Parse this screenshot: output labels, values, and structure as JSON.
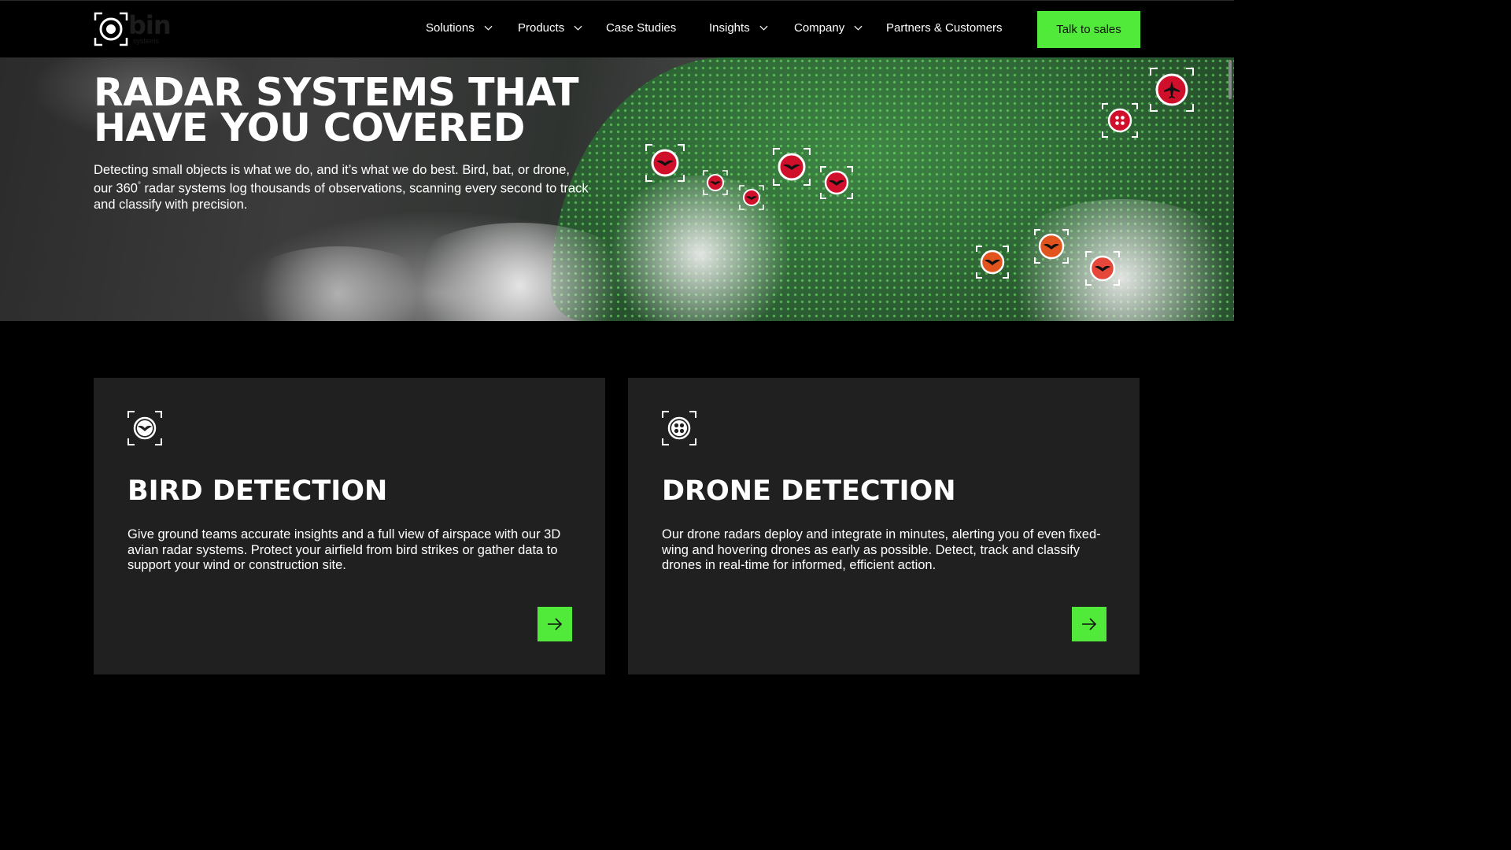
{
  "nav": {
    "logo_word": "bin",
    "logo_sub": "systems",
    "items": [
      {
        "label": "Solutions",
        "has_dropdown": true
      },
      {
        "label": "Products",
        "has_dropdown": true
      },
      {
        "label": "Case Studies",
        "has_dropdown": false
      },
      {
        "label": "Insights",
        "has_dropdown": true
      },
      {
        "label": "Company",
        "has_dropdown": true
      },
      {
        "label": "Partners & Customers",
        "has_dropdown": false
      }
    ],
    "cta_label": "Talk to sales"
  },
  "hero": {
    "title_line1": "RADAR SYSTEMS THAT",
    "title_line2": "HAVE YOU COVERED",
    "body_part1": "Detecting small objects is what we do, and it’s what we do best. Bird, bat, or drone, our 360",
    "body_degree": "°",
    "body_part2": " radar systems log thousands of observations, scanning every second to track and classify with precision."
  },
  "cards": [
    {
      "icon": "bird-detection-icon",
      "title": "BIRD DETECTION",
      "text": "Give ground teams accurate insights and a full view of airspace with our 3D avian radar systems. Protect your airfield from bird strikes or gather data to support your wind or construction site."
    },
    {
      "icon": "drone-detection-icon",
      "title": "DRONE DETECTION",
      "text": "Our drone radars deploy and integrate in minutes, alerting you of even fixed-wing and hovering drones as early as possible. Detect, track and classify drones in real-time for informed, efficient action."
    }
  ],
  "colors": {
    "accent": "#52ea3a",
    "background": "#000000",
    "card": "#202020",
    "marker_red": "#d0102a",
    "marker_orange": "#e2541d"
  }
}
